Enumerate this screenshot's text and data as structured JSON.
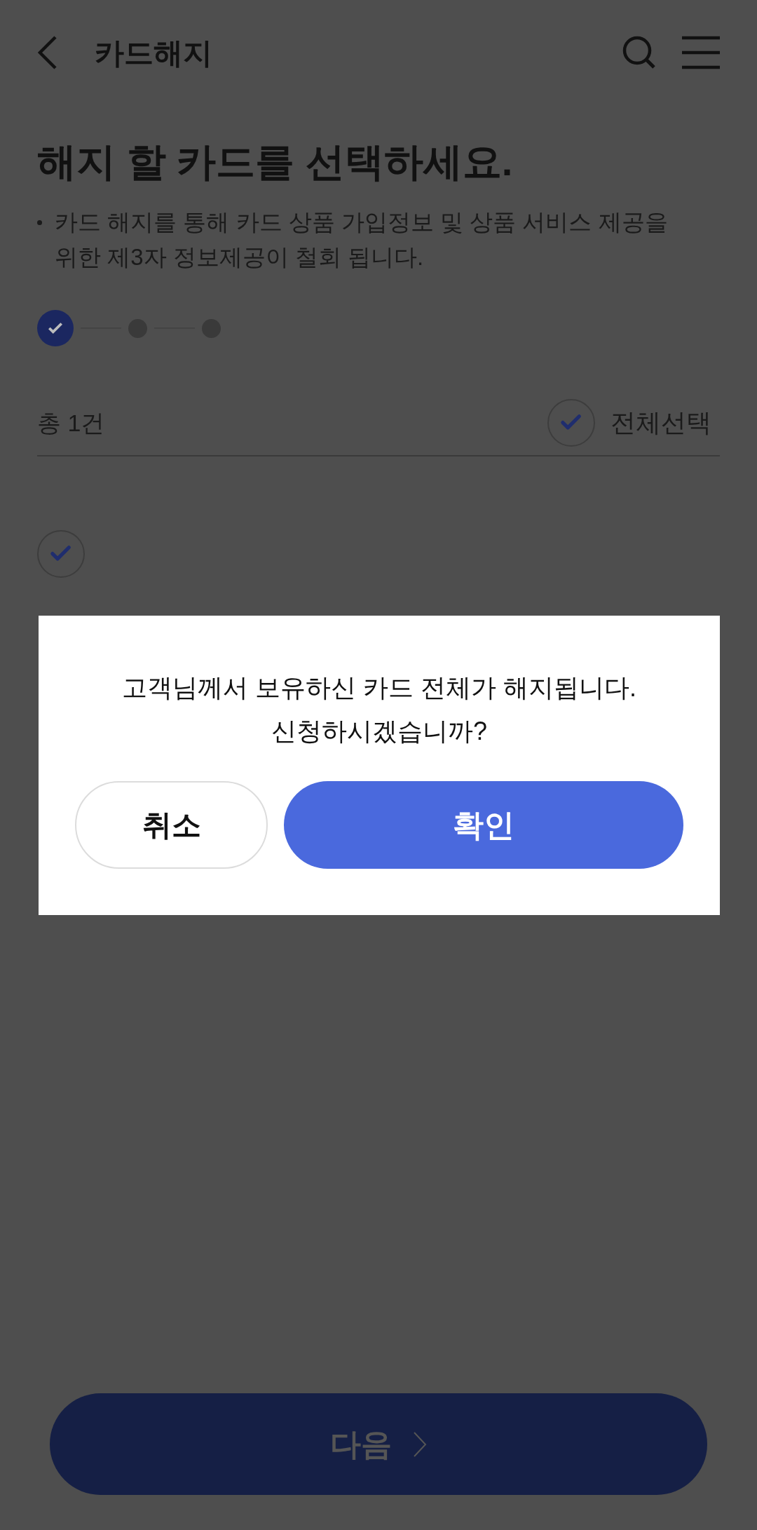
{
  "header": {
    "title": "카드해지"
  },
  "heading": "해지 할 카드를 선택하세요.",
  "notice": "카드 해지를 통해 카드 상품 가입정보 및 상품 서비스 제공을 위한 제3자 정보제공이 철회 됩니다.",
  "steps": [
    {
      "done": true
    },
    {
      "done": false
    },
    {
      "done": false
    }
  ],
  "total": "총 1건",
  "select_all": {
    "label": "전체선택",
    "checked": true
  },
  "cards": [
    {
      "checked": true
    }
  ],
  "dialog": {
    "message_lines": [
      "고객님께서 보유하신 카드 전체가 해지됩니다.",
      "신청하시겠습니까?"
    ],
    "cancel": "취소",
    "confirm": "확인"
  },
  "next_button": {
    "label": "다음",
    "disabled": true
  }
}
